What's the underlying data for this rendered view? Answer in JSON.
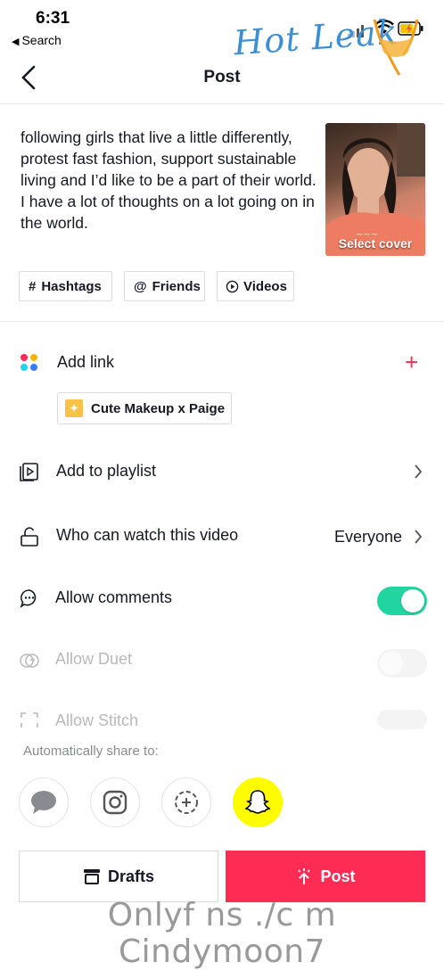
{
  "status_bar": {
    "time": "6:31",
    "back_app": "Search"
  },
  "watermark": {
    "logo_text": "Hot Leak",
    "footer_text": "Onlyf ns ./c m Cindymoon7"
  },
  "nav": {
    "title": "Post"
  },
  "caption": "following girls that live a little differently, protest fast fashion, support sustainable living and I’d like to be a part of their world. I have a lot of thoughts on a lot going on in the world.",
  "cover": {
    "label": "Select cover"
  },
  "chips": {
    "hashtags": "Hashtags",
    "friends": "Friends",
    "videos": "Videos"
  },
  "add_link": {
    "label": "Add link",
    "plus": "+",
    "chip_label": "Cute Makeup x Paige"
  },
  "playlist": {
    "label": "Add to playlist"
  },
  "privacy": {
    "label": "Who can watch this video",
    "value": "Everyone"
  },
  "comments": {
    "label": "Allow comments",
    "on": true
  },
  "duet": {
    "label": "Allow Duet",
    "on": false
  },
  "stitch": {
    "label": "Allow Stitch",
    "on": false
  },
  "share": {
    "label": "Automatically share to:"
  },
  "colors": {
    "accent": "#fe2c55",
    "toggle_on": "#20d5a0",
    "snapchat": "#fffc00"
  },
  "buttons": {
    "drafts": "Drafts",
    "post": "Post"
  }
}
